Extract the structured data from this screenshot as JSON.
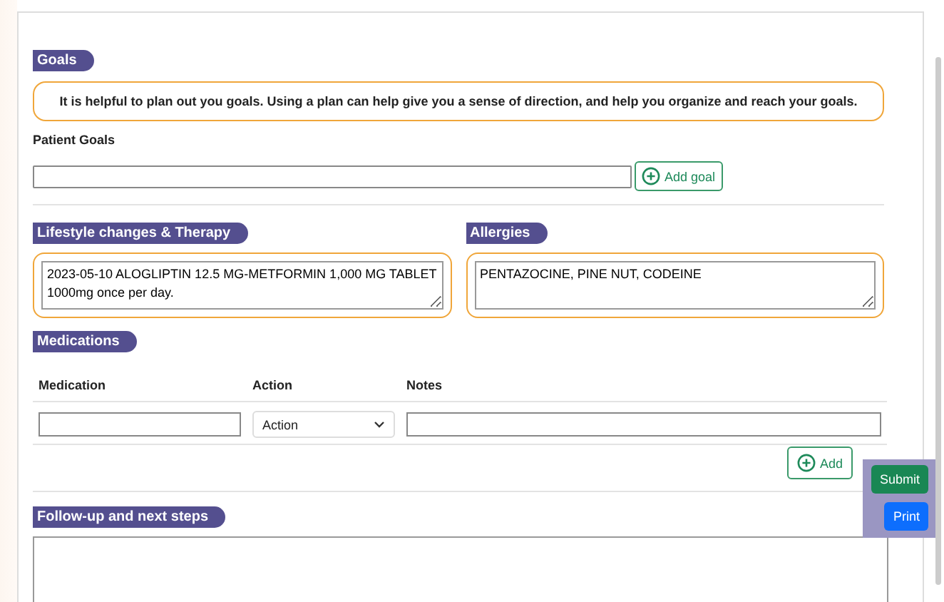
{
  "goals": {
    "heading": "Goals",
    "info": "It is helpful to plan out you goals. Using a plan can help give you a sense of direction, and help you organize and reach your goals.",
    "patient_goals_label": "Patient Goals",
    "add_goal_button": "Add goal"
  },
  "lifestyle": {
    "heading": "Lifestyle changes & Therapy",
    "value": "2023-05-10 ALOGLIPTIN 12.5 MG-METFORMIN 1,000 MG TABLET 1000mg once per day."
  },
  "allergies": {
    "heading": "Allergies",
    "value": "PENTAZOCINE, PINE NUT, CODEINE"
  },
  "medications": {
    "heading": "Medications",
    "columns": [
      "Medication",
      "Action",
      "Notes"
    ],
    "rows": [
      {
        "action": "Action"
      }
    ],
    "add_button": "Add"
  },
  "follow_up": {
    "heading": "Follow-up and next steps"
  },
  "floating_actions": [
    "Submit",
    "Print"
  ]
}
